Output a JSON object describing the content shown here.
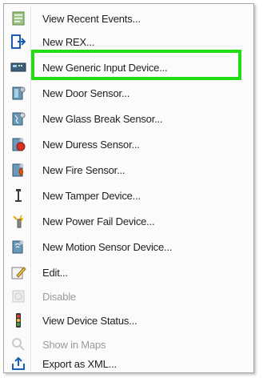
{
  "menu": {
    "items": [
      {
        "label": "View Recent Events...",
        "icon": "recent-events-icon",
        "enabled": true
      },
      {
        "label": "New REX...",
        "icon": "rex-icon",
        "enabled": true
      },
      {
        "label": "New Generic Input Device...",
        "icon": "generic-input-icon",
        "enabled": true,
        "highlighted": true
      },
      {
        "label": "New Door Sensor...",
        "icon": "door-sensor-icon",
        "enabled": true
      },
      {
        "label": "New Glass Break Sensor...",
        "icon": "glass-break-sensor-icon",
        "enabled": true
      },
      {
        "label": "New Duress Sensor...",
        "icon": "duress-sensor-icon",
        "enabled": true
      },
      {
        "label": "New Fire Sensor...",
        "icon": "fire-sensor-icon",
        "enabled": true
      },
      {
        "label": "New Tamper Device...",
        "icon": "tamper-device-icon",
        "enabled": true
      },
      {
        "label": "New Power Fail Device...",
        "icon": "power-fail-icon",
        "enabled": true
      },
      {
        "label": "New Motion Sensor Device...",
        "icon": "motion-sensor-icon",
        "enabled": true
      },
      {
        "label": "Edit...",
        "icon": "edit-icon",
        "enabled": true
      },
      {
        "label": "Disable",
        "icon": "disable-icon",
        "enabled": false
      },
      {
        "label": "View Device Status...",
        "icon": "device-status-icon",
        "enabled": true
      },
      {
        "label": "Show in Maps",
        "icon": "maps-icon",
        "enabled": false
      },
      {
        "label": "Export as XML...",
        "icon": "export-xml-icon",
        "enabled": true
      }
    ]
  },
  "colors": {
    "highlight_border": "#22dd11",
    "menu_background": "#fbfbfb",
    "disabled_text": "#9a9a9a"
  }
}
